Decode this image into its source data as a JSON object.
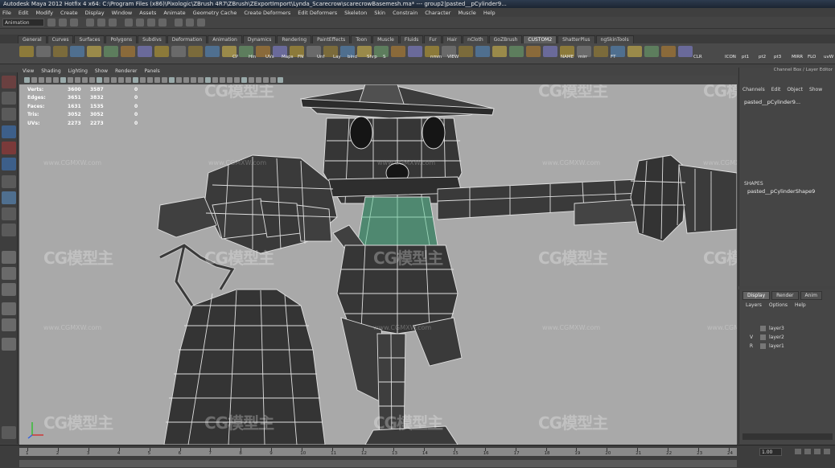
{
  "window": {
    "title": "Autodesk Maya 2012 Hotfix 4 x64: C:\\Program Files (x86)\\Pixologic\\ZBrush 4R7\\ZBrush\\ZExportImport\\Lynda_Scarecrow\\scarecrowBasemesh.ma*  ---  group2|pasted__pCylinder9..."
  },
  "menubar": [
    "File",
    "Edit",
    "Modify",
    "Create",
    "Display",
    "Window",
    "Assets",
    "Animate",
    "Geometry Cache",
    "Create Deformers",
    "Edit Deformers",
    "Skeleton",
    "Skin",
    "Constrain",
    "Character",
    "Muscle",
    "Help"
  ],
  "statusline": {
    "mode": "Animation"
  },
  "shelf_tabs": [
    {
      "label": "General"
    },
    {
      "label": "Curves"
    },
    {
      "label": "Surfaces"
    },
    {
      "label": "Polygons"
    },
    {
      "label": "Subdivs"
    },
    {
      "label": "Deformation"
    },
    {
      "label": "Animation"
    },
    {
      "label": "Dynamics"
    },
    {
      "label": "Rendering"
    },
    {
      "label": "PaintEffects"
    },
    {
      "label": "Toon"
    },
    {
      "label": "Muscle"
    },
    {
      "label": "Fluids"
    },
    {
      "label": "Fur"
    },
    {
      "label": "Hair"
    },
    {
      "label": "nCloth"
    },
    {
      "label": "GoZBrush"
    },
    {
      "label": "CUSTOM2",
      "active": true
    },
    {
      "label": "ShatterPlus"
    },
    {
      "label": "ngSkinTools"
    }
  ],
  "shelf_labels": [
    "CP",
    "Hin",
    "UVs",
    "Maps",
    "FN",
    "Unf",
    "Lay",
    "blnd",
    "Shrp",
    "S",
    "nmm",
    "VIEW",
    "NAME",
    "mirr",
    "FT",
    "CLR",
    "ICON",
    "pt1",
    "pt2",
    "pt3",
    "MIRR",
    "FLO",
    "uvW"
  ],
  "panel_menu": [
    "View",
    "Shading",
    "Lighting",
    "Show",
    "Renderer",
    "Panels"
  ],
  "hud": {
    "rows": [
      {
        "label": "Verts:",
        "a": "3600",
        "b": "3587",
        "c": "0"
      },
      {
        "label": "Edges:",
        "a": "3651",
        "b": "3832",
        "c": "0"
      },
      {
        "label": "Faces:",
        "a": "1631",
        "b": "1535",
        "c": "0"
      },
      {
        "label": "Tris:",
        "a": "3052",
        "b": "3052",
        "c": "0"
      },
      {
        "label": "UVs:",
        "a": "2273",
        "b": "2273",
        "c": "0"
      }
    ]
  },
  "watermark": {
    "text": "CG模型主",
    "url": "www.CGMXW.com"
  },
  "channel_box": {
    "title": "Channel Box / Layer Editor",
    "menu": [
      "Channels",
      "Edit",
      "Object",
      "Show"
    ],
    "object_name": "pasted__pCylinder9...",
    "shapes_header": "SHAPES",
    "shape_name": "pasted__pCylinderShape9"
  },
  "layer_editor": {
    "tabs": [
      {
        "label": "Display",
        "active": true
      },
      {
        "label": "Render"
      },
      {
        "label": "Anim"
      }
    ],
    "menu": [
      "Layers",
      "Options",
      "Help"
    ],
    "layers": [
      {
        "vis": "",
        "name": "layer3"
      },
      {
        "vis": "V",
        "name": "layer2"
      },
      {
        "vis": "R",
        "name": "layer1"
      }
    ]
  },
  "timeline": {
    "ticks": [
      "1",
      "2",
      "3",
      "4",
      "5",
      "6",
      "7",
      "8",
      "9",
      "10",
      "11",
      "12",
      "13",
      "14",
      "15",
      "16",
      "17",
      "18",
      "19",
      "20",
      "21",
      "22",
      "23",
      "24"
    ],
    "current_frame": "1.00"
  }
}
